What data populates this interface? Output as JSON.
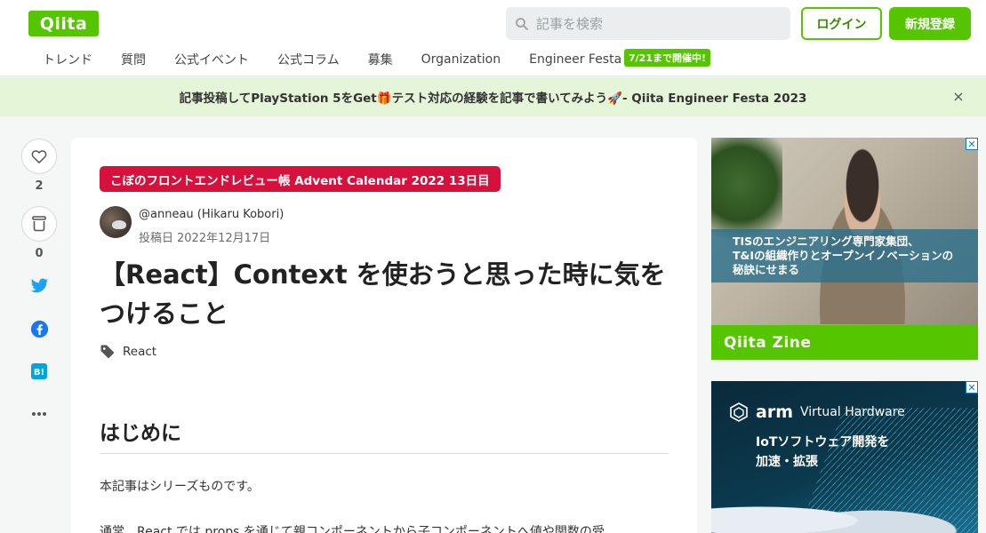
{
  "header": {
    "logo": "Qiita",
    "search_placeholder": "記事を検索",
    "login_label": "ログイン",
    "signup_label": "新規登録"
  },
  "nav": {
    "items": [
      "トレンド",
      "質問",
      "公式イベント",
      "公式コラム",
      "募集",
      "Organization",
      "Engineer Festa"
    ],
    "badge": "7/21まで開催中!"
  },
  "banner": {
    "text": "記事投稿してPlayStation 5をGet🎁テスト対応の経験を記事で書いてみよう🚀- Qiita Engineer Festa 2023",
    "close": "×"
  },
  "side": {
    "like_count": "2",
    "stock_count": "0",
    "icons": [
      "heart-icon",
      "stock-icon",
      "twitter-icon",
      "facebook-icon",
      "hatena-bookmark-icon",
      "more-icon"
    ]
  },
  "article": {
    "calendar": "こぼのフロントエンドレビュー帳 Advent Calendar 2022 13日目",
    "author": "@anneau (Hikaru Kobori)",
    "posted_label": "投稿日",
    "posted_date": "2022年12月17日",
    "title": "【React】Context を使おうと思った時に気をつけること",
    "tag": "React",
    "section_heading": "はじめに",
    "paragraph1": "本記事はシリーズものです。",
    "paragraph2": "通常、React では props を通じて親コンポーネントから子コンポーネントへ値や関数の受"
  },
  "ads": {
    "ad1_caption_line1": "TISのエンジニアリング専門家集団、",
    "ad1_caption_line2": "T&Iの組織作りとオープンイノベーションの",
    "ad1_caption_line3": "秘訣にせまる",
    "ad1_brand": "Qiita Zine",
    "ad2_brand": "arm",
    "ad2_product": "Virtual Hardware",
    "ad2_line1": "IoTソフトウェア開発を",
    "ad2_line2": "加速・拡張"
  },
  "colors": {
    "brand_green": "#55c500",
    "banner_bg": "#e5f6d8",
    "calendar_red": "#d6123c",
    "twitter": "#1da1f2",
    "facebook": "#1877f2",
    "hatena": "#00a4de"
  }
}
